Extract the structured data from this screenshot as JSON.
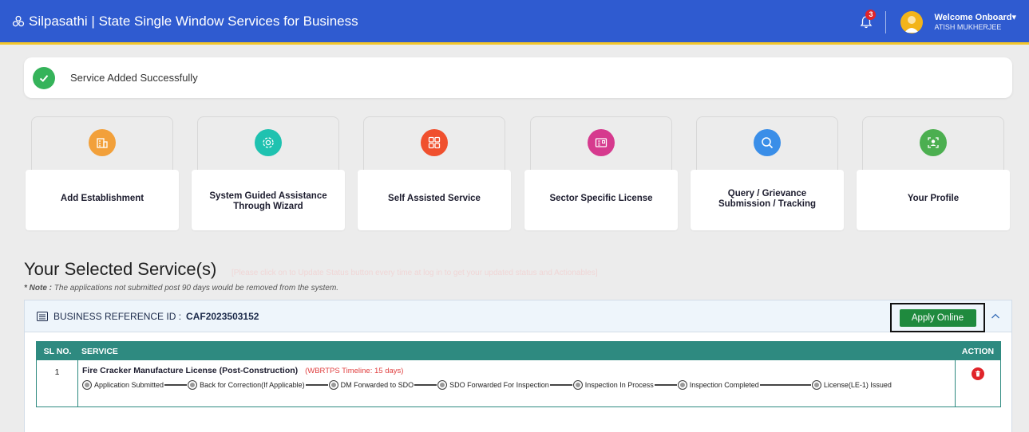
{
  "header": {
    "title": "Silpasathi | State Single Window Services for Business",
    "notification_count": "3",
    "welcome": "Welcome Onboard",
    "user_name": "ATISH MUKHERJEE"
  },
  "alert": {
    "message": "Service Added Successfully"
  },
  "tiles": [
    {
      "label": "Add Establishment",
      "icon": "building-icon",
      "color": "#f2a03a"
    },
    {
      "label": "System Guided Assistance Through Wizard",
      "icon": "gear-icon",
      "color": "#1fc2b0"
    },
    {
      "label": "Self Assisted Service",
      "icon": "checklist-icon",
      "color": "#f0502e"
    },
    {
      "label": "Sector Specific License",
      "icon": "license-icon",
      "color": "#d63a8e"
    },
    {
      "label": "Query / Grievance Submission / Tracking",
      "icon": "search-icon",
      "color": "#3a8ee8"
    },
    {
      "label": "Your Profile",
      "icon": "profile-icon",
      "color": "#4caf50"
    }
  ],
  "selected": {
    "title": "Your Selected Service(s)",
    "hint": "[Please click on to Update Status button every time at log in to get your updated status and Actionables]",
    "note_label": "* Note :",
    "note_text": "The applications not submitted post 90 days would be removed from the system."
  },
  "business": {
    "ref_label": "BUSINESS REFERENCE ID :",
    "ref_id": "CAF2023503152",
    "apply_label": "Apply Online"
  },
  "table": {
    "headers": {
      "sl": "SL NO.",
      "service": "SERVICE",
      "action": "ACTION"
    },
    "rows": [
      {
        "sl": "1",
        "service": "Fire Cracker Manufacture License (Post-Construction)",
        "timeline": "(WBRTPS Timeline: 15 days)",
        "steps": [
          "Application Submitted",
          "Back for Correction(If Applicable)",
          "DM Forwarded to SDO",
          "SDO Forwarded For Inspection",
          "Inspection In Process",
          "Inspection Completed",
          "License(LE-1) Issued"
        ]
      }
    ]
  },
  "colors": {
    "header_bg": "#2f5bd0",
    "header_accent": "#f3c62b",
    "table_header": "#2e8a80",
    "apply_button": "#1f8a3e",
    "success": "#35b35a",
    "delete": "#e0242a"
  }
}
